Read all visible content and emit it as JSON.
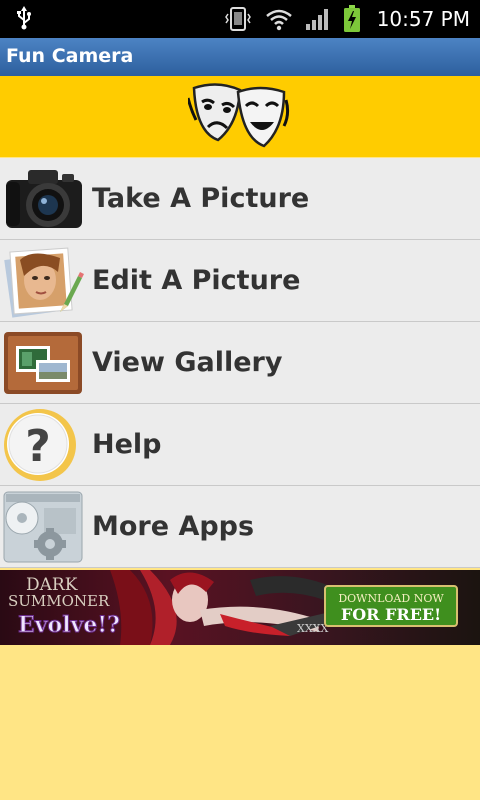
{
  "status_bar": {
    "time": "10:57 PM",
    "icons": [
      "usb-icon",
      "vibrate-icon",
      "wifi-icon",
      "signal-icon",
      "battery-charging-icon"
    ]
  },
  "app": {
    "title": "Fun Camera"
  },
  "banner": {
    "icon": "theater-masks-icon"
  },
  "menu": {
    "items": [
      {
        "label": "Take A Picture",
        "icon": "camera-icon"
      },
      {
        "label": "Edit A Picture",
        "icon": "edit-picture-icon"
      },
      {
        "label": "View Gallery",
        "icon": "gallery-icon"
      },
      {
        "label": "Help",
        "icon": "help-icon"
      },
      {
        "label": "More Apps",
        "icon": "more-apps-icon"
      }
    ]
  },
  "ad": {
    "brand_line1": "DARK",
    "brand_line2": "SUMMONER",
    "tagline": "Evolve!?",
    "cta_line1": "DOWNLOAD NOW",
    "cta_line2": "FOR FREE!",
    "blade_text": "XXXX"
  },
  "colors": {
    "title_bar": "#3a6fb0",
    "banner_bg": "#ffcc00",
    "page_bg": "#ffe585",
    "menu_bg": "#ececec",
    "menu_text": "#333333",
    "cta_green": "#3f8f1e"
  }
}
